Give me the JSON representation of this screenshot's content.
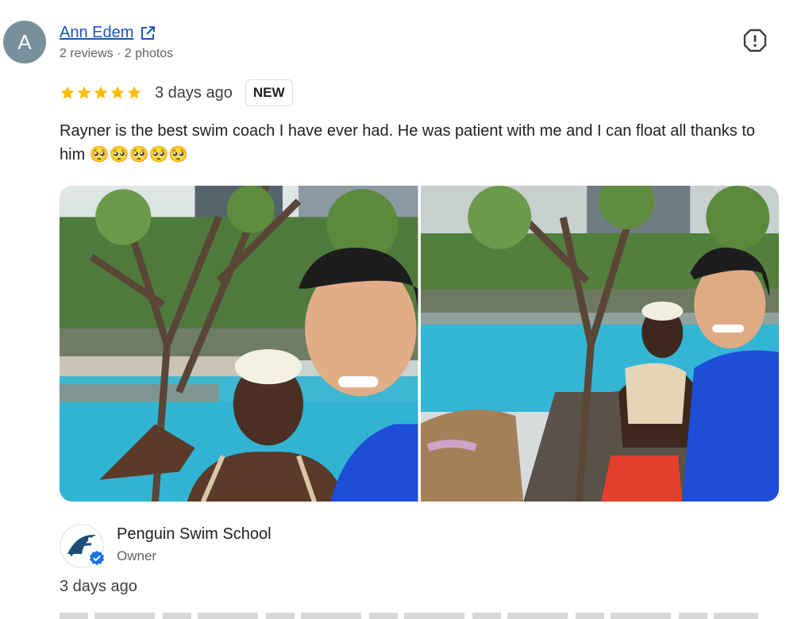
{
  "review": {
    "avatar_letter": "A",
    "author_name": "Ann Edem",
    "author_meta": "2 reviews · 2 photos",
    "rating": 5,
    "date": "3 days ago",
    "badge": "NEW",
    "text": "Rayner is the best swim coach I have ever had. He was patient with me and I can float all thanks to him 🥺🥺🥺🥺🥺",
    "photos": [
      {
        "icon": "photo-pool-selfie"
      },
      {
        "icon": "photo-pool-poolside"
      }
    ]
  },
  "owner_response": {
    "name": "Penguin Swim School",
    "role": "Owner",
    "date": "3 days ago"
  },
  "icons": {
    "external_link": "open-in-new-icon",
    "report": "report-flag-icon",
    "star": "star-icon",
    "verified": "verified-badge-icon"
  },
  "colors": {
    "link": "#1a57b6",
    "star": "#fbbc04",
    "avatar": "#78909c",
    "verified": "#1a73e8"
  }
}
